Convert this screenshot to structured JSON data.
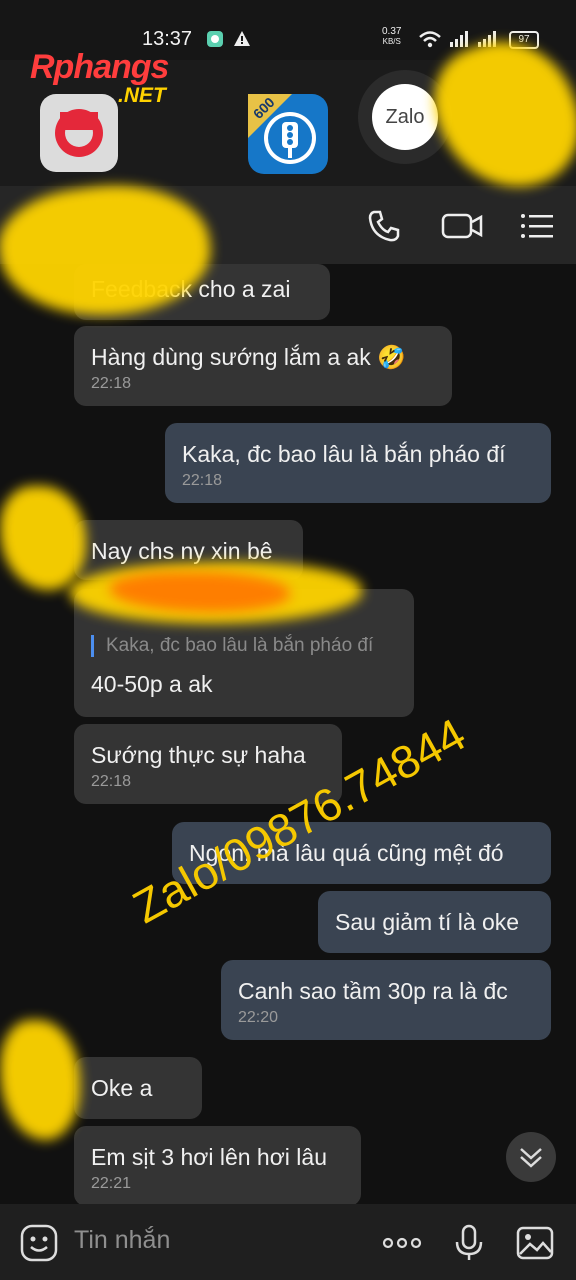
{
  "status_bar": {
    "time": "13:37",
    "net_speed_value": "0.37",
    "net_speed_unit": "KB/S",
    "battery": "97"
  },
  "overlay": {
    "logo_main": "Rphangs",
    "logo_suffix": ".NET",
    "zalo_label": "Zalo",
    "traffic_badge": "600"
  },
  "messages": [
    {
      "text": "Feedback cho a zai",
      "time": ""
    },
    {
      "text": "Hàng dùng sướng lắm a ak 🤣",
      "time": "22:18"
    },
    {
      "text": "Kaka, đc bao lâu là bắn pháo đí",
      "time": "22:18"
    },
    {
      "text": "Nay chs ny xin bê",
      "time": ""
    },
    {
      "quote": "Kaka, đc bao lâu là bắn pháo đí",
      "text": "40-50p a ak",
      "time": ""
    },
    {
      "text": "Sướng thực sự haha",
      "time": "22:18"
    },
    {
      "text": "Ngon, mà lâu quá cũng mệt đó",
      "time": ""
    },
    {
      "text": "Sau giảm tí là oke",
      "time": ""
    },
    {
      "text": "Canh sao tầm 30p ra là đc",
      "time": "22:20"
    },
    {
      "text": "Oke a",
      "time": ""
    },
    {
      "text": "Em sịt 3 hơi lên hơi lâu",
      "time": "22:21"
    }
  ],
  "input": {
    "placeholder": "Tin nhắn"
  },
  "watermark": "Zalo/09876.74844",
  "colors": {
    "incoming_bubble": "#343434",
    "outgoing_bubble": "#3a4452",
    "watermark": "#f5c800"
  },
  "icons": [
    "wifi-icon",
    "signal-icon",
    "battery-icon",
    "phone-icon",
    "video-call-icon",
    "menu-icon",
    "emoji-icon",
    "more-icon",
    "microphone-icon",
    "image-icon",
    "chevron-down-icon"
  ]
}
